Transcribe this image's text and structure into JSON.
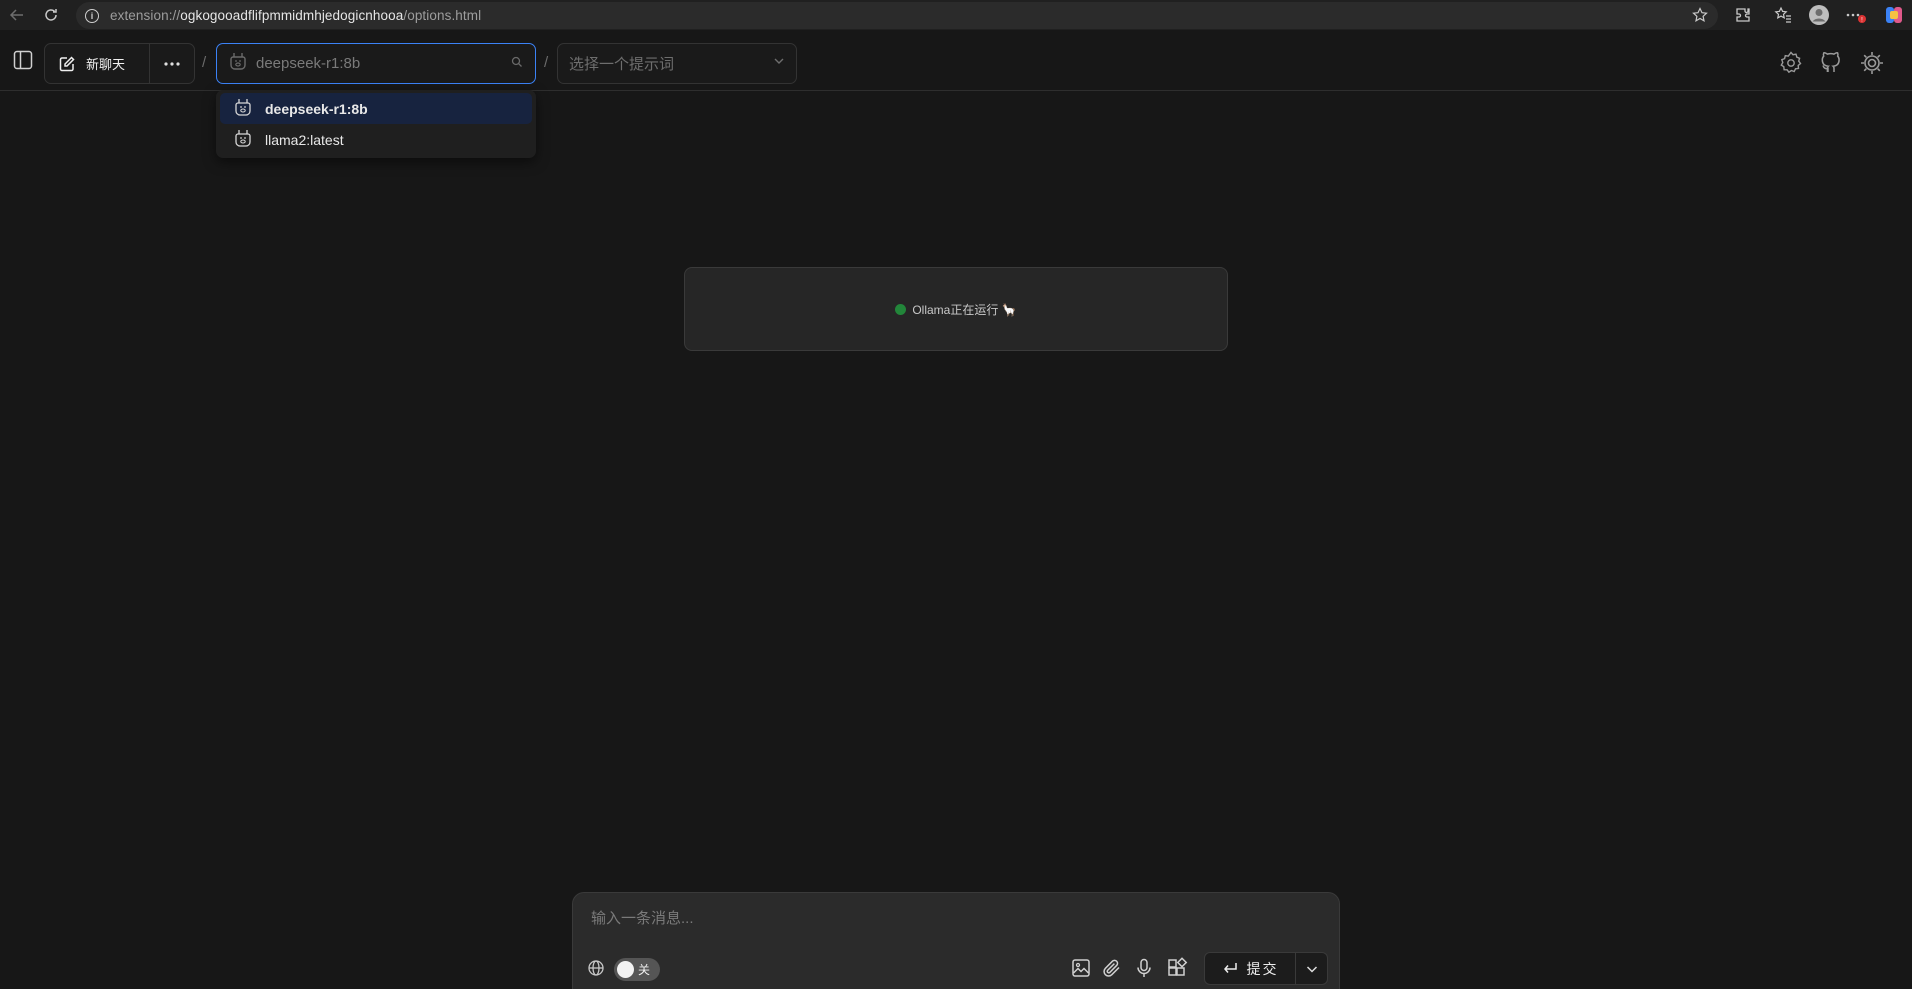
{
  "browser": {
    "url_scheme": "extension://",
    "url_host": "ogkogooadflifpmmidmhjedogicnhooa",
    "url_path": "/options.html"
  },
  "toolbar": {
    "new_chat_label": "新聊天",
    "model_value": "deepseek-r1:8b",
    "prompt_placeholder": "选择一个提示词",
    "separator": "/"
  },
  "model_dropdown": {
    "items": [
      {
        "label": "deepseek-r1:8b",
        "active": true
      },
      {
        "label": "llama2:latest",
        "active": false
      }
    ]
  },
  "status": {
    "text": "Ollama正在运行 🦙",
    "color": "#22863a"
  },
  "composer": {
    "placeholder": "输入一条消息...",
    "web_search_toggle_label": "关",
    "submit_label": "提交"
  }
}
